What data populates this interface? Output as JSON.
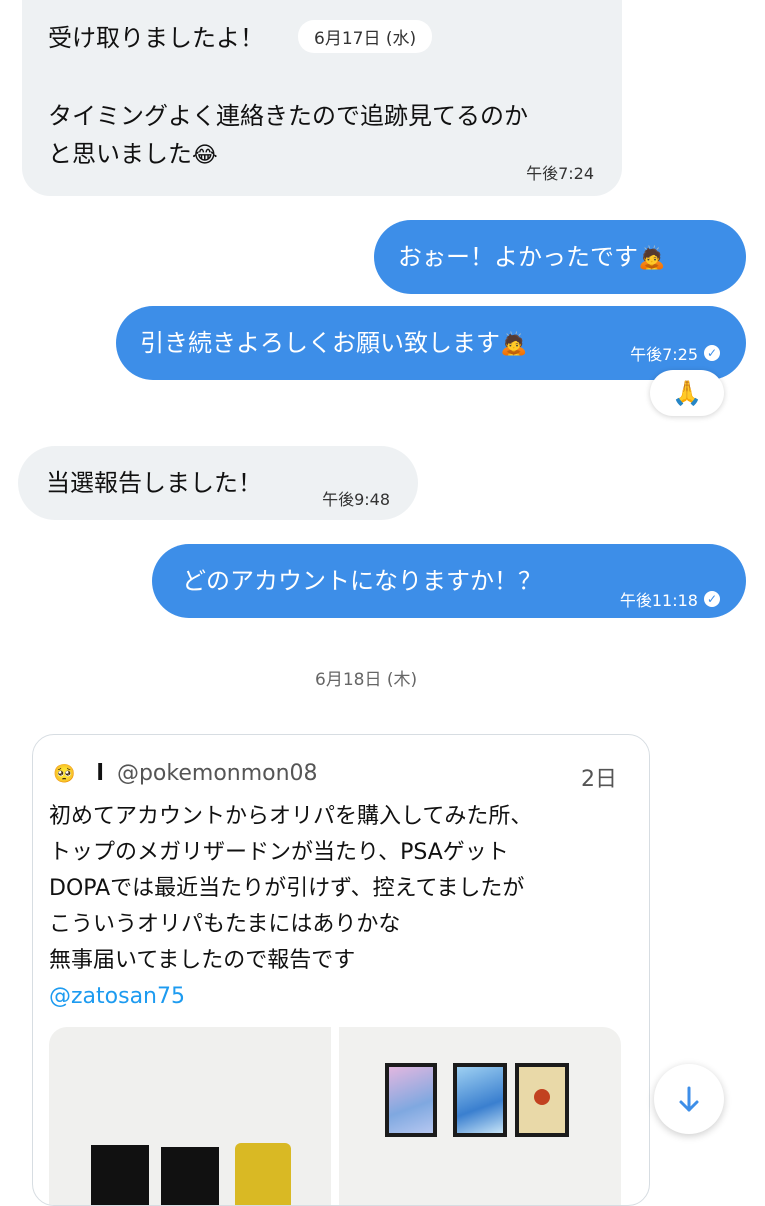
{
  "messages": {
    "m1": {
      "line1": "受け取りましたよ！",
      "line2": "タイミングよく連絡きたので追跡見てるのか",
      "line3": "と思いました",
      "emoji": "😂",
      "time": "午後7:24"
    },
    "date1": "6月17日 (水)",
    "m2": {
      "text": "おぉー！よかったです",
      "emoji": "🙇"
    },
    "m3": {
      "text": "引き続きよろしくお願い致します",
      "emoji": "🙇",
      "time": "午後7:25"
    },
    "reaction": "🙏",
    "m4": {
      "text": "当選報告しました！",
      "time": "午後9:48"
    },
    "m5": {
      "text": "どのアカウントになりますか！？",
      "time": "午後11:18"
    },
    "date2": "6月18日 (木)"
  },
  "tweet": {
    "avatar_emoji": "🥺",
    "name": "l",
    "handle": "@pokemonmon08",
    "age": "2日",
    "lines": [
      "初めてアカウントからオリパを購入してみた所、",
      "トップのメガリザードンが当たり、PSAゲット",
      "DOPAでは最近当たりが引けず、控えてましたが",
      "こういうオリパもたまにはありかな",
      "無事届いてましたので報告です"
    ],
    "mention": "@zatosan75"
  },
  "colors": {
    "outgoing": "#3d8ee8",
    "incoming": "#eef1f3",
    "mention": "#1d9bf0"
  },
  "icons": {
    "read_check": "check-circle-icon",
    "scroll_down": "arrow-down-icon"
  }
}
